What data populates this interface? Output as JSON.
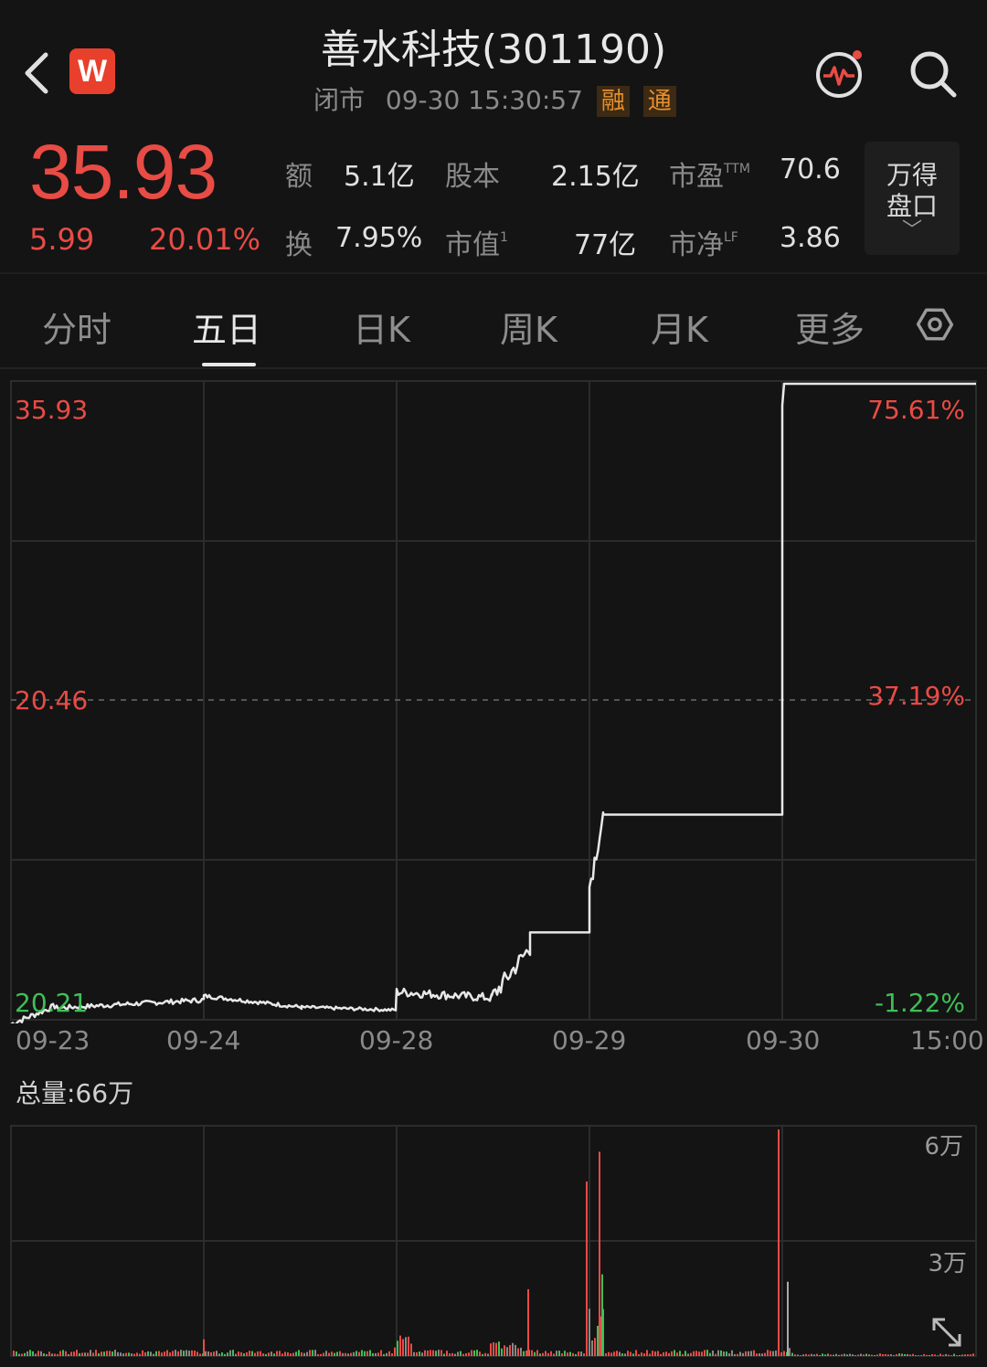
{
  "header": {
    "title": "善水科技(301190)",
    "status": "闭市",
    "datetime": "09-30 15:30:57",
    "tags": [
      "融",
      "通"
    ],
    "logo_letter": "W"
  },
  "quote": {
    "price": "35.93",
    "change": "5.99",
    "change_pct": "20.01%",
    "metrics": [
      {
        "label": "额",
        "value": "5.1亿"
      },
      {
        "label": "股本",
        "value": "2.15亿"
      },
      {
        "label": "市盈",
        "sup": "TTM",
        "value": "70.6"
      },
      {
        "label": "换",
        "value": "7.95%"
      },
      {
        "label": "市值",
        "sup": "1",
        "value": "77亿"
      },
      {
        "label": "市净",
        "sup": "LF",
        "value": "3.86"
      }
    ],
    "panel_button": [
      "万得",
      "盘口"
    ]
  },
  "tabs": [
    "分时",
    "五日",
    "日K",
    "周K",
    "月K",
    "更多"
  ],
  "active_tab": "五日",
  "price_axis": {
    "high": "35.93",
    "mid": "20.46",
    "low": "20.21",
    "pct_high": "75.61%",
    "pct_mid": "37.19%",
    "pct_low": "-1.22%"
  },
  "dates": [
    "09-23",
    "09-24",
    "09-28",
    "09-29",
    "09-30",
    "15:00"
  ],
  "volume": {
    "total_label": "总量:66万",
    "axis": [
      "6万",
      "3万"
    ]
  },
  "colors": {
    "up": "#e94b45",
    "down": "#3fbf56",
    "line": "#e8e8e8",
    "grid": "#2c2c2c"
  },
  "icons": [
    "back-chevron-icon",
    "pulse-icon",
    "search-icon",
    "settings-hexagon-icon",
    "expand-icon"
  ],
  "chart_data": {
    "type": "line",
    "x": [
      "09-23",
      "09-24",
      "09-28",
      "09-29",
      "09-30"
    ],
    "series": [
      {
        "values": [
          20.46,
          20.6,
          21.4,
          24.9,
          35.93
        ]
      }
    ],
    "ylim": [
      20.21,
      35.93
    ],
    "grid": true
  }
}
